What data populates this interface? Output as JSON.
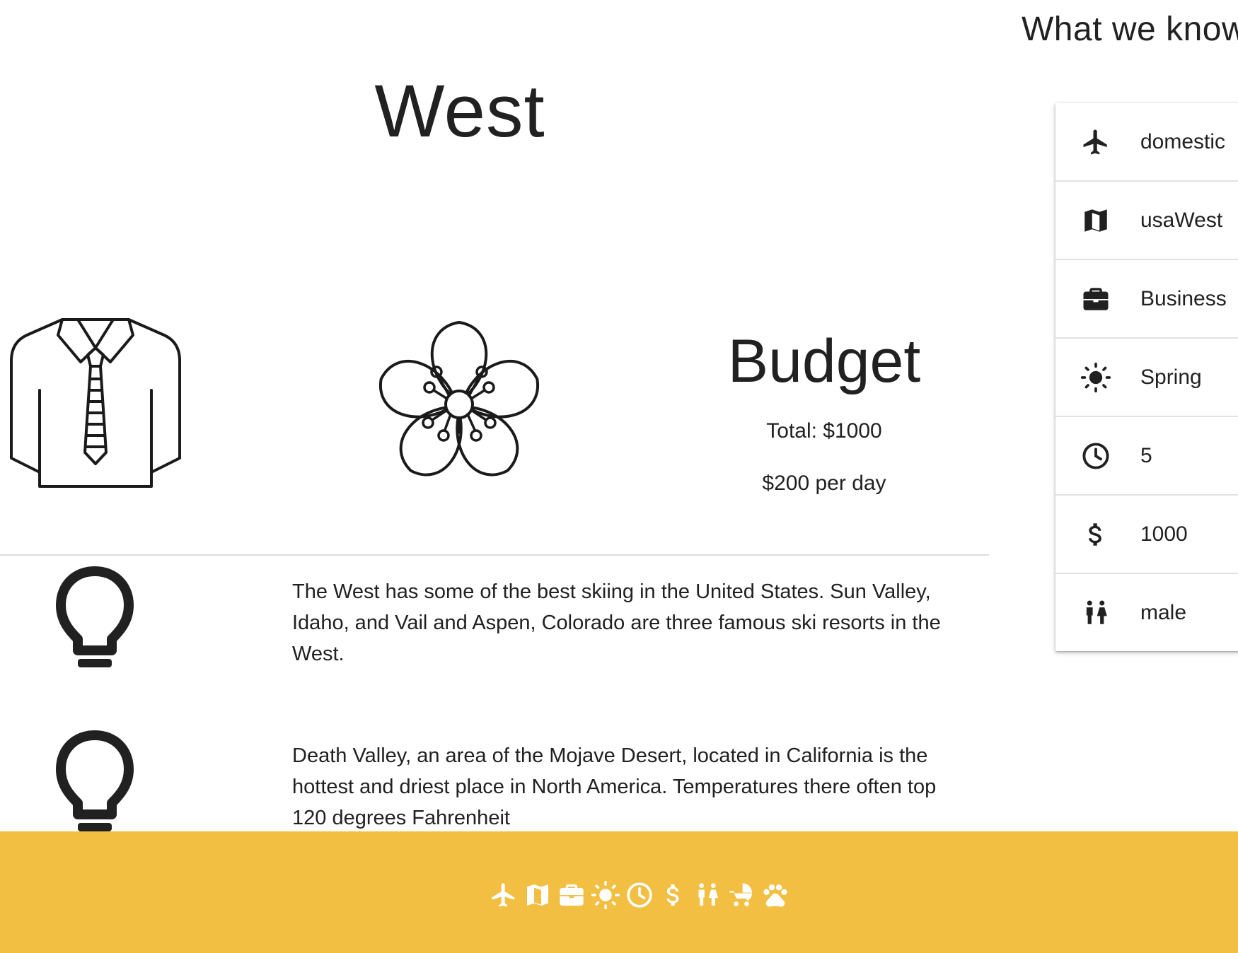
{
  "sidebar": {
    "title": "What we know",
    "items": [
      {
        "icon": "airplane-icon",
        "label": "domestic"
      },
      {
        "icon": "map-icon",
        "label": "usaWest"
      },
      {
        "icon": "briefcase-icon",
        "label": "Business"
      },
      {
        "icon": "sun-icon",
        "label": "Spring"
      },
      {
        "icon": "clock-icon",
        "label": "5"
      },
      {
        "icon": "dollar-icon",
        "label": "1000"
      },
      {
        "icon": "people-icon",
        "label": "male"
      }
    ]
  },
  "main": {
    "region_title": "West",
    "illustrations": [
      "shirt-tie-icon",
      "flower-icon"
    ],
    "budget": {
      "title": "Budget",
      "total": "Total: $1000",
      "per_day": "$200 per day"
    },
    "tips": [
      {
        "icon": "lightbulb-icon",
        "text": "The West has some of the best skiing in the United States. Sun Valley, Idaho, and Vail and Aspen, Colorado are three famous ski resorts in the West."
      },
      {
        "icon": "lightbulb-icon",
        "text": "Death Valley, an area of the Mojave Desert, located in California is the hottest and driest place in North America. Temperatures there often top 120 degrees Fahrenheit"
      }
    ]
  },
  "footer": {
    "background": "#f2bf42",
    "icons": [
      "airplane-icon",
      "map-icon",
      "briefcase-icon",
      "sun-icon",
      "clock-icon",
      "dollar-icon",
      "people-icon",
      "stroller-icon",
      "paw-icon"
    ]
  }
}
